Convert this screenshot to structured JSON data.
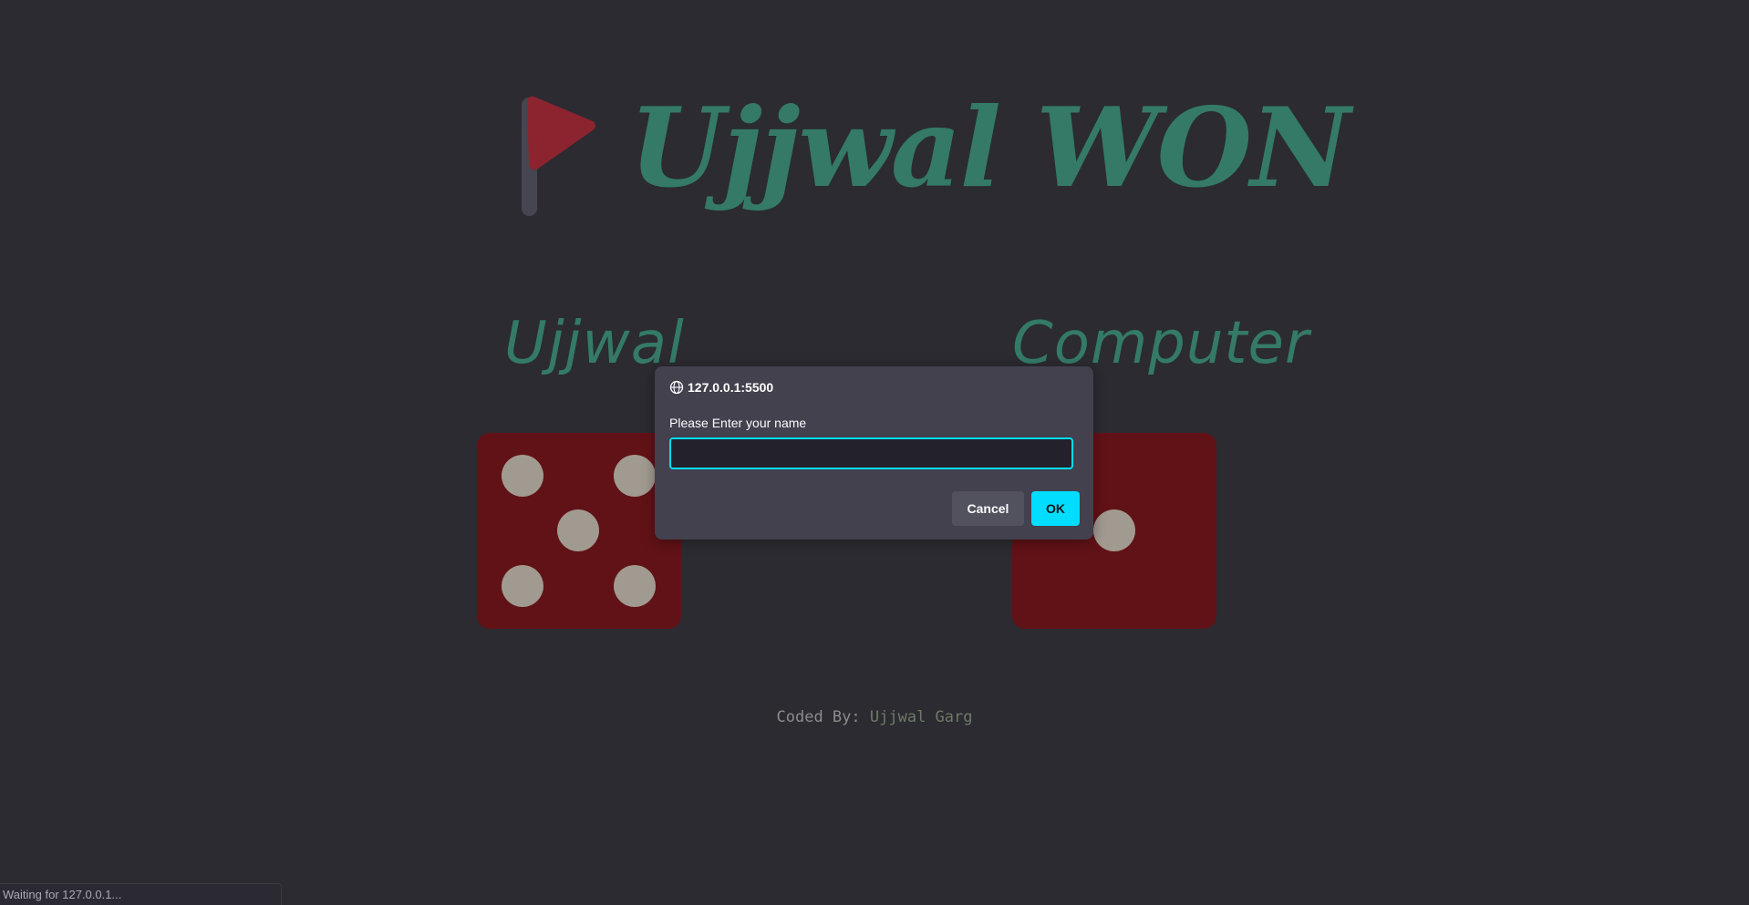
{
  "game": {
    "result_title": "Ujjwal WON",
    "player1_name": "Ujjwal",
    "player2_name": "Computer",
    "player1_dice_value": 5,
    "player2_dice_value": 1,
    "credit_label": "Coded By:",
    "credit_author": "Ujjwal Garg",
    "colors": {
      "background": "#2b2b31",
      "title": "#347a66",
      "dice": "#611216",
      "pip": "#a19a90",
      "flag": "#8c2430"
    }
  },
  "dialog": {
    "origin": "127.0.0.1:5500",
    "message": "Please Enter your name",
    "input_value": "",
    "cancel_label": "Cancel",
    "ok_label": "OK",
    "accent_color": "#00ddff"
  },
  "statusbar": {
    "text": "Waiting for 127.0.0.1..."
  }
}
